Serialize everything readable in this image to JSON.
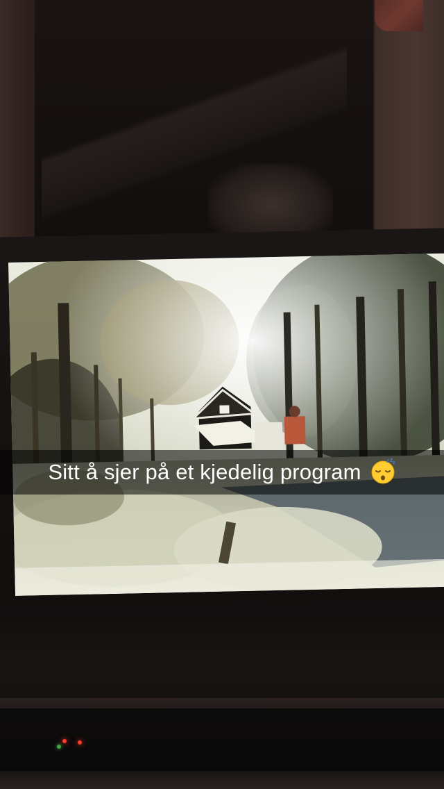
{
  "caption": {
    "text": "Sitt å sjer på et kjedelig program",
    "emoji": "sleeping-face-icon"
  },
  "colors": {
    "caption_bar": "#000000",
    "caption_text": "#ffffff",
    "led_red": "#ff3b30",
    "led_green": "#3fa74a"
  }
}
